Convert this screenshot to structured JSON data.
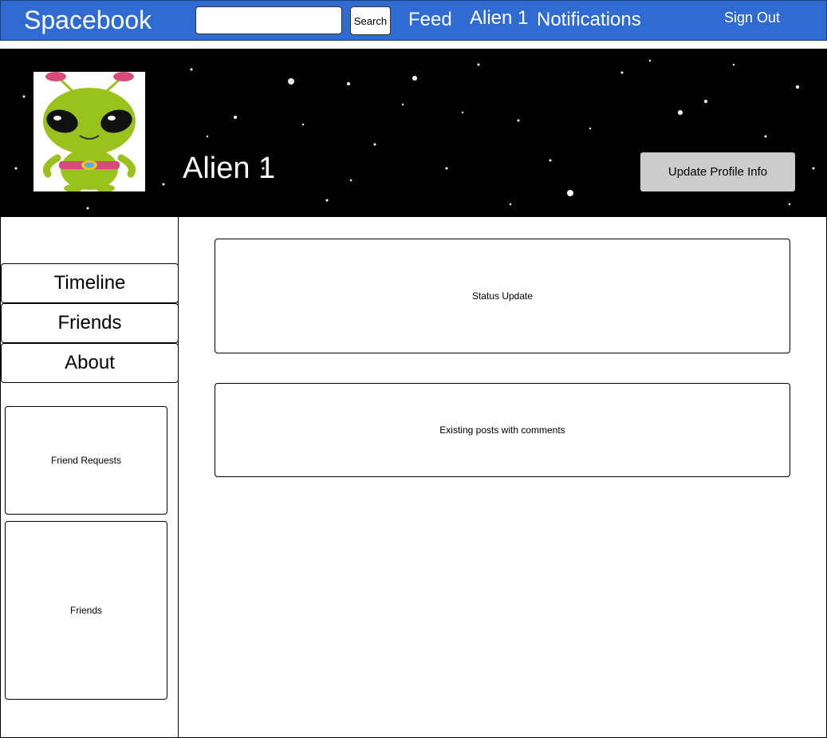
{
  "header": {
    "brand": "Spacebook",
    "search_value": "",
    "search_button": "Search",
    "nav_feed": "Feed",
    "nav_profile": "Alien 1",
    "nav_notifications": "Notifications",
    "nav_signout": "Sign Out"
  },
  "profile": {
    "name": "Alien 1",
    "update_button": "Update Profile Info"
  },
  "sidebar": {
    "tabs": [
      {
        "label": "Timeline"
      },
      {
        "label": "Friends"
      },
      {
        "label": "About"
      }
    ],
    "friend_requests": "Friend Requests",
    "friends": "Friends"
  },
  "main": {
    "status_update": "Status Update",
    "existing_posts": "Existing posts with comments"
  },
  "colors": {
    "topbar": "#2f6bd0",
    "cover": "#000000",
    "button_gray": "#cccccc",
    "alien_green": "#9ac21c",
    "antenna_pink": "#d84a7c"
  }
}
